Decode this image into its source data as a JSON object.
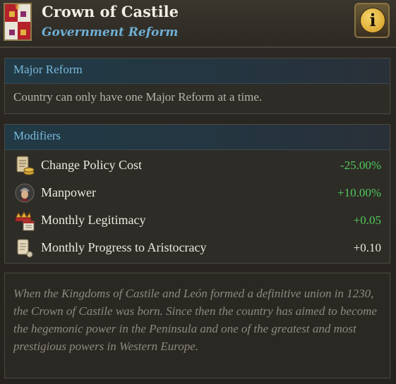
{
  "header": {
    "title": "Crown of Castile",
    "subtitle": "Government Reform",
    "info_glyph": "i"
  },
  "major_reform": {
    "heading": "Major Reform",
    "text": "Country can only have one Major Reform at a time."
  },
  "modifiers": {
    "heading": "Modifiers",
    "items": [
      {
        "icon": "scroll-coins-icon",
        "label": "Change Policy Cost",
        "value": "-25.00%",
        "color": "#4ec95c"
      },
      {
        "icon": "soldier-icon",
        "label": "Manpower",
        "value": "+10.00%",
        "color": "#4ec95c"
      },
      {
        "icon": "crown-calendar-icon",
        "label": "Monthly Legitimacy",
        "value": "+0.05",
        "color": "#4ec95c"
      },
      {
        "icon": "scroll-icon",
        "label": "Monthly Progress to Aristocracy",
        "value": "+0.10",
        "color": "#ece8de"
      }
    ]
  },
  "flavor": {
    "text": "When the Kingdoms of Castile and León formed a definitive union in 1230, the Crown of Castile was born. Since then the country has aimed to become the hegemonic power in the Peninsula and one of the greatest and most prestigious powers in Western Europe."
  },
  "colors": {
    "accent_blue": "#78b9dc",
    "positive_green": "#4ec95c"
  }
}
